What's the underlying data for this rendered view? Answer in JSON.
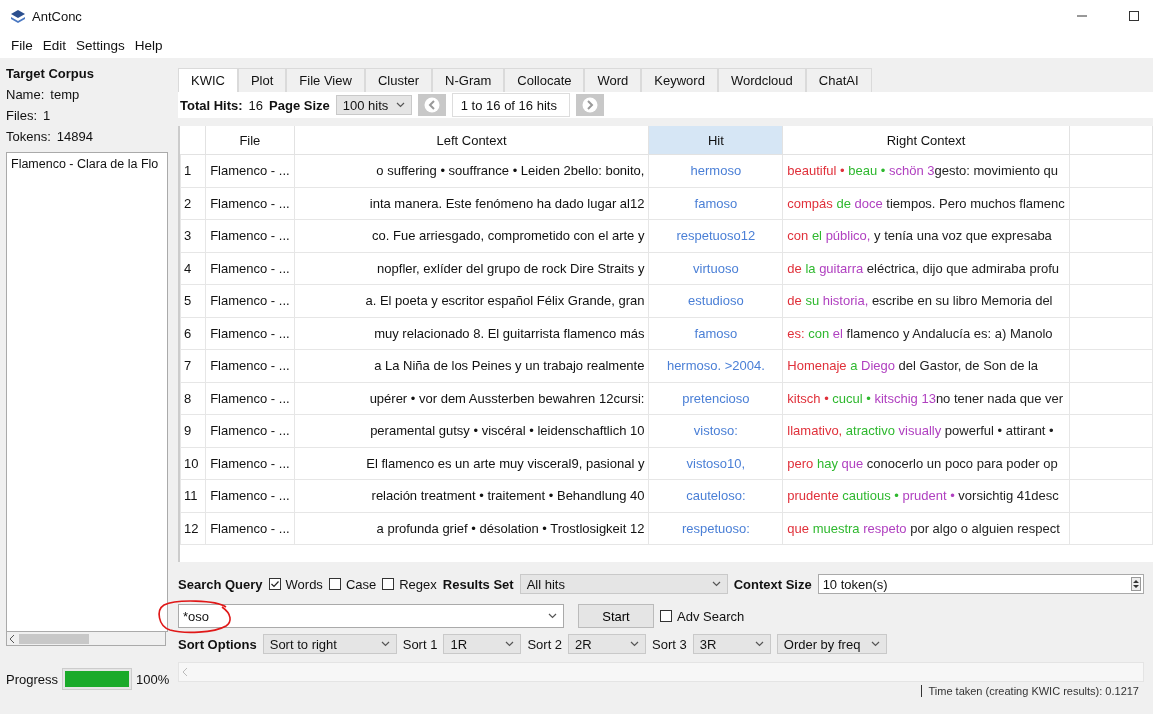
{
  "window": {
    "title": "AntConc"
  },
  "menu": [
    "File",
    "Edit",
    "Settings",
    "Help"
  ],
  "corpus": {
    "heading": "Target Corpus",
    "name_label": "Name:",
    "name": "temp",
    "files_label": "Files:",
    "files": "1",
    "tokens_label": "Tokens:",
    "tokens": "14894",
    "items": [
      {
        "label": "Flamenco - Clara de la Flo",
        "selected": false
      }
    ]
  },
  "progress": {
    "label": "Progress",
    "level": 1,
    "reading": "100%"
  },
  "tabs": [
    {
      "label": "KWIC",
      "selected": true
    },
    {
      "label": "Plot",
      "selected": false
    },
    {
      "label": "File View",
      "selected": false
    },
    {
      "label": "Cluster",
      "selected": false
    },
    {
      "label": "N-Gram",
      "selected": false
    },
    {
      "label": "Collocate",
      "selected": false
    },
    {
      "label": "Word",
      "selected": false
    },
    {
      "label": "Keyword",
      "selected": false
    },
    {
      "label": "Wordcloud",
      "selected": false
    },
    {
      "label": "ChatAI",
      "selected": false
    }
  ],
  "toolbar": {
    "total_label": "Total Hits:",
    "total": "16",
    "page_size_label": "Page Size",
    "page_size": "100 hits",
    "range": "1 to 16 of 16 hits"
  },
  "table": {
    "columns": [
      {
        "label": "File",
        "highlighted": false
      },
      {
        "label": "Left Context",
        "highlighted": false
      },
      {
        "label": "Hit",
        "highlighted": true
      },
      {
        "label": "Right Context",
        "highlighted": false
      }
    ],
    "rows": [
      {
        "n": "1",
        "file": "Flamenco - ...",
        "left": "o suffering • souffrance • Leiden 2bello: bonito,",
        "hit": "hermoso",
        "right": [
          {
            "text": "beautiful • ",
            "color": "#e0303a"
          },
          {
            "text": "beau • ",
            "color": "#2eb82e"
          },
          {
            "text": "schön 3",
            "color": "#b040c0"
          },
          {
            "text": "gesto: movimiento qu",
            "color": "#222222"
          }
        ]
      },
      {
        "n": "2",
        "file": "Flamenco - ...",
        "left": "inta manera. Este fenómeno ha dado lugar al12",
        "hit": "famoso",
        "right": [
          {
            "text": "compás ",
            "color": "#e0303a"
          },
          {
            "text": "de ",
            "color": "#2eb82e"
          },
          {
            "text": "doce",
            "color": "#b040c0"
          },
          {
            "text": " tiempos. Pero muchos flamenc",
            "color": "#222222"
          }
        ]
      },
      {
        "n": "3",
        "file": "Flamenco - ...",
        "left": "co. Fue arriesgado, comprometido con el arte y",
        "hit": "respetuoso12",
        "right": [
          {
            "text": "con ",
            "color": "#e0303a"
          },
          {
            "text": "el ",
            "color": "#2eb82e"
          },
          {
            "text": "público,",
            "color": "#b040c0"
          },
          {
            "text": " y tenía una voz que expresaba",
            "color": "#222222"
          }
        ]
      },
      {
        "n": "4",
        "file": "Flamenco - ...",
        "left": "nopfler, exlíder del grupo de rock Dire Straits y",
        "hit": "virtuoso",
        "right": [
          {
            "text": "de ",
            "color": "#e0303a"
          },
          {
            "text": "la ",
            "color": "#2eb82e"
          },
          {
            "text": "guitarra",
            "color": "#b040c0"
          },
          {
            "text": " eléctrica, dijo que admiraba profu",
            "color": "#222222"
          }
        ]
      },
      {
        "n": "5",
        "file": "Flamenco - ...",
        "left": "a. El poeta y escritor español Félix Grande, gran",
        "hit": "estudioso",
        "right": [
          {
            "text": "de ",
            "color": "#e0303a"
          },
          {
            "text": "su ",
            "color": "#2eb82e"
          },
          {
            "text": "historia,",
            "color": "#b040c0"
          },
          {
            "text": " escribe en su libro Memoria del",
            "color": "#222222"
          }
        ]
      },
      {
        "n": "6",
        "file": "Flamenco - ...",
        "left": "muy relacionado 8. El guitarrista flamenco más",
        "hit": "famoso",
        "right": [
          {
            "text": "es: ",
            "color": "#e0303a"
          },
          {
            "text": "con ",
            "color": "#2eb82e"
          },
          {
            "text": "el",
            "color": "#b040c0"
          },
          {
            "text": " flamenco y Andalucía es: a) Manolo",
            "color": "#222222"
          }
        ]
      },
      {
        "n": "7",
        "file": "Flamenco - ...",
        "left": "a La Niña de los Peines y un trabajo realmente",
        "hit": "hermoso. >2004.",
        "right": [
          {
            "text": "Homenaje ",
            "color": "#e0303a"
          },
          {
            "text": "a ",
            "color": "#2eb82e"
          },
          {
            "text": "Diego",
            "color": "#b040c0"
          },
          {
            "text": " del Gastor, de Son de la",
            "color": "#222222"
          }
        ]
      },
      {
        "n": "8",
        "file": "Flamenco - ...",
        "left": "upérer • vor dem Aussterben bewahren 12cursi:",
        "hit": "pretencioso",
        "right": [
          {
            "text": "kitsch • ",
            "color": "#e0303a"
          },
          {
            "text": "cucul • ",
            "color": "#2eb82e"
          },
          {
            "text": "kitschig 13",
            "color": "#b040c0"
          },
          {
            "text": "no tener nada que ver",
            "color": "#222222"
          }
        ]
      },
      {
        "n": "9",
        "file": "Flamenco - ...",
        "left": "peramental gutsy • viscéral • leidenschaftlich 10",
        "hit": "vistoso:",
        "right": [
          {
            "text": "llamativo, ",
            "color": "#e0303a"
          },
          {
            "text": "atractivo ",
            "color": "#2eb82e"
          },
          {
            "text": "visually",
            "color": "#b040c0"
          },
          {
            "text": " powerful • attirant •",
            "color": "#222222"
          }
        ]
      },
      {
        "n": "10",
        "file": "Flamenco - ...",
        "left": "El flamenco es un arte muy visceral9, pasional y",
        "hit": "vistoso10,",
        "right": [
          {
            "text": "pero ",
            "color": "#e0303a"
          },
          {
            "text": "hay ",
            "color": "#2eb82e"
          },
          {
            "text": "que",
            "color": "#b040c0"
          },
          {
            "text": " conocerlo un poco para poder op",
            "color": "#222222"
          }
        ]
      },
      {
        "n": "11",
        "file": "Flamenco - ...",
        "left": "relación treatment • traitement • Behandlung 40",
        "hit": "cauteloso:",
        "right": [
          {
            "text": "prudente ",
            "color": "#e0303a"
          },
          {
            "text": "cautious • ",
            "color": "#2eb82e"
          },
          {
            "text": "prudent •",
            "color": "#b040c0"
          },
          {
            "text": " vorsichtig 41desc",
            "color": "#222222"
          }
        ]
      },
      {
        "n": "12",
        "file": "Flamenco - ...",
        "left": "a profunda grief • désolation • Trostlosigkeit 12",
        "hit": "respetuoso:",
        "right": [
          {
            "text": "que ",
            "color": "#e0303a"
          },
          {
            "text": "muestra ",
            "color": "#2eb82e"
          },
          {
            "text": "respeto",
            "color": "#b040c0"
          },
          {
            "text": " por algo o alguien respect",
            "color": "#222222"
          }
        ]
      }
    ]
  },
  "search": {
    "label": "Search Query",
    "options": [
      {
        "label": "Words",
        "checked": true
      },
      {
        "label": "Case",
        "checked": false
      },
      {
        "label": "Regex",
        "checked": false
      }
    ],
    "results_label": "Results Set",
    "results": "All hits",
    "context_label": "Context Size",
    "context": "10 token(s)",
    "query": "*oso",
    "start": "Start",
    "adv": {
      "label": "Adv Search",
      "checked": false
    }
  },
  "sort": {
    "label": "Sort Options",
    "mode": "Sort to right",
    "levels": [
      {
        "label": "Sort 1",
        "value": "1R"
      },
      {
        "label": "Sort 2",
        "value": "2R"
      },
      {
        "label": "Sort 3",
        "value": "3R"
      }
    ],
    "order": "Order by freq"
  },
  "status_bar": "Time taken (creating KWIC results): 0.1217"
}
